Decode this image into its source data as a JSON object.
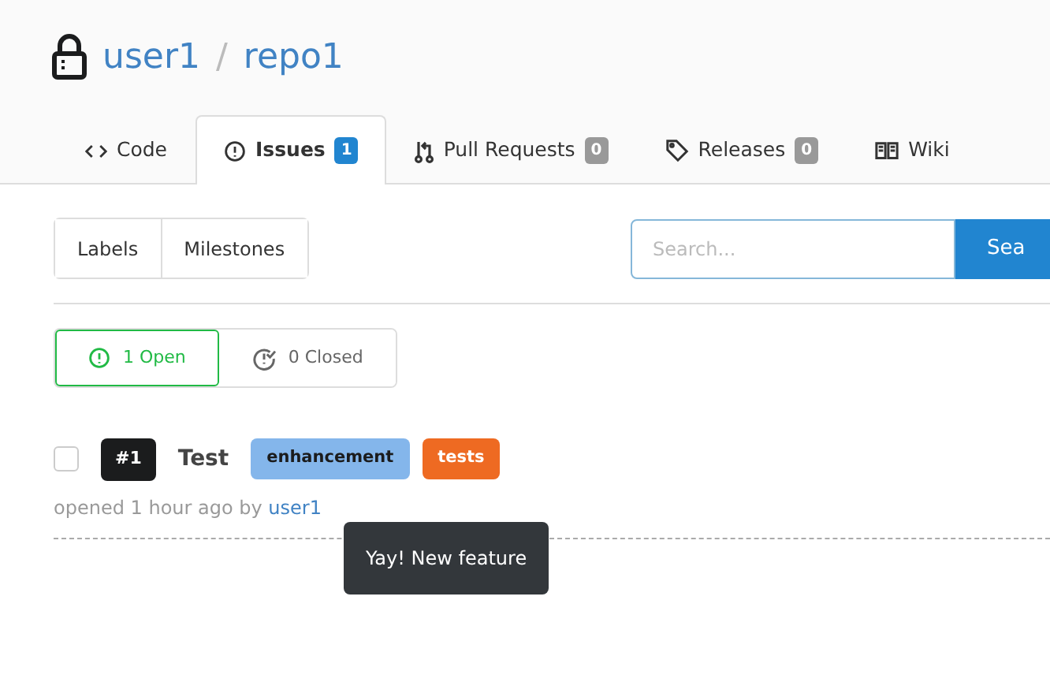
{
  "repo": {
    "owner": "user1",
    "separator": "/",
    "name": "repo1",
    "private": true
  },
  "tabs": [
    {
      "label": "Code",
      "selected": false
    },
    {
      "label": "Issues",
      "count": "1",
      "selected": true
    },
    {
      "label": "Pull Requests",
      "count": "0",
      "selected": false
    },
    {
      "label": "Releases",
      "count": "0",
      "selected": false
    },
    {
      "label": "Wiki",
      "selected": false
    }
  ],
  "filters": [
    "Labels",
    "Milestones"
  ],
  "search": {
    "placeholder": "Search...",
    "button": "Sea"
  },
  "states": [
    {
      "label": "1 Open",
      "selected": true
    },
    {
      "label": "0 Closed",
      "selected": false
    }
  ],
  "issues": [
    {
      "checked": false,
      "number": "#1",
      "title": "Test",
      "labels": [
        {
          "text": "enhancement",
          "color": "#84b6eb"
        },
        {
          "text": "tests",
          "color": "#ee6a22"
        }
      ],
      "meta": "opened 1 hour ago by",
      "author": "user1"
    }
  ],
  "tooltip": "Yay! New feature"
}
